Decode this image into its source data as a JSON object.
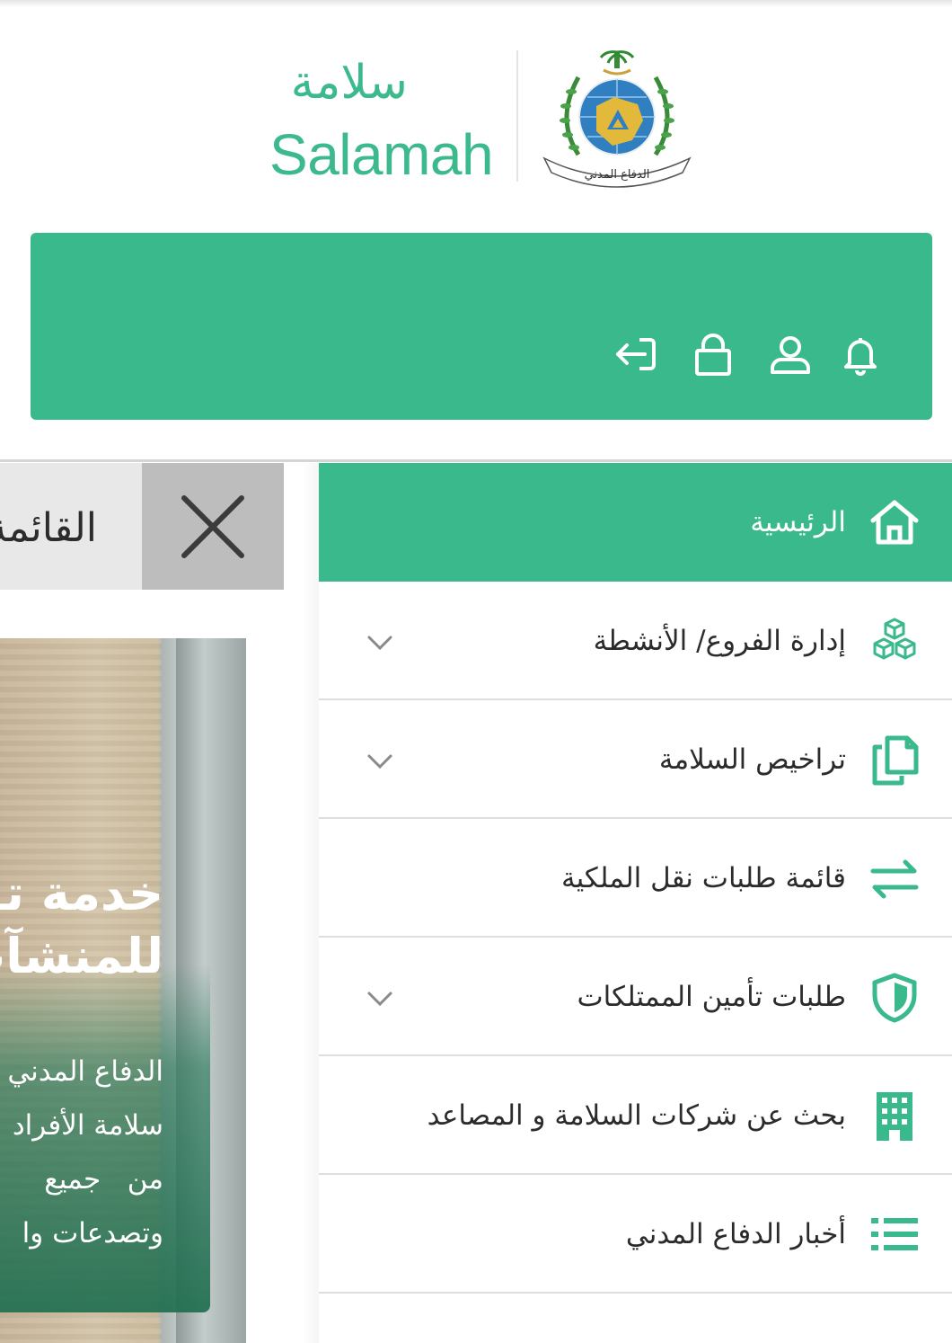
{
  "brand": {
    "name_ar": "سلامة",
    "name_en": "Salamah",
    "emblem_text": "الدفاع المدني"
  },
  "colors": {
    "accent": "#3ab98c",
    "text": "#2b2b2b",
    "divider": "#dedede"
  },
  "top_actions": [
    {
      "name": "notification-bell-icon"
    },
    {
      "name": "user-profile-icon"
    },
    {
      "name": "lock-icon"
    },
    {
      "name": "logout-icon"
    }
  ],
  "left_panel": {
    "tab_text": "القائمة",
    "hero_title_line1": "خدمة تـ",
    "hero_title_line2": "للمنشآت",
    "hero_lines": [
      "الدفاع المدني",
      "سلامة الأفراد",
      "من   جميع",
      "وتصدعات وا"
    ]
  },
  "menu": {
    "items": [
      {
        "label": "الرئيسية",
        "icon": "home-icon",
        "active": true,
        "has_chevron": false
      },
      {
        "label": "إدارة الفروع/ الأنشطة",
        "icon": "boxes-icon",
        "active": false,
        "has_chevron": true
      },
      {
        "label": "تراخيص السلامة",
        "icon": "documents-icon",
        "active": false,
        "has_chevron": true
      },
      {
        "label": "قائمة طلبات نقل الملكية",
        "icon": "transfer-arrows-icon",
        "active": false,
        "has_chevron": false
      },
      {
        "label": "طلبات تأمين الممتلكات",
        "icon": "shield-icon",
        "active": false,
        "has_chevron": true
      },
      {
        "label": "بحث عن شركات السلامة و المصاعد",
        "icon": "building-icon",
        "active": false,
        "has_chevron": false
      },
      {
        "label": "أخبار الدفاع المدني",
        "icon": "list-icon",
        "active": false,
        "has_chevron": false
      }
    ]
  }
}
